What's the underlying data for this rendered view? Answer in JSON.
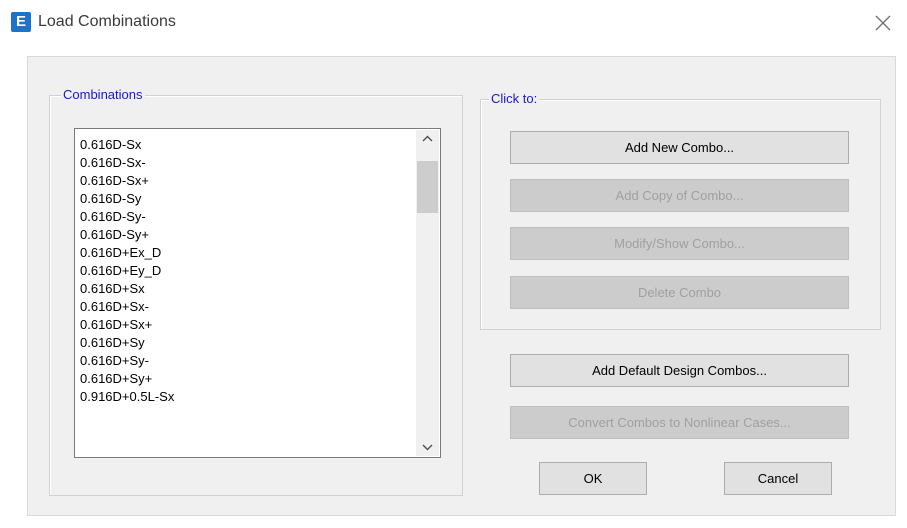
{
  "window": {
    "title": "Load Combinations",
    "app_icon_letter": "E"
  },
  "combinations": {
    "label": "Combinations",
    "items": [
      "0.616D-Sx",
      "0.616D-Sx-",
      "0.616D-Sx+",
      "0.616D-Sy",
      "0.616D-Sy-",
      "0.616D-Sy+",
      "0.616D+Ex_D",
      "0.616D+Ey_D",
      "0.616D+Sx",
      "0.616D+Sx-",
      "0.616D+Sx+",
      "0.616D+Sy",
      "0.616D+Sy-",
      "0.616D+Sy+",
      "0.916D+0.5L-Sx"
    ]
  },
  "click_to": {
    "label": "Click to:",
    "add_new": "Add New Combo...",
    "add_copy": "Add Copy of Combo...",
    "modify_show": "Modify/Show Combo...",
    "delete": "Delete Combo"
  },
  "buttons": {
    "add_default": "Add Default Design Combos...",
    "convert": "Convert Combos to Nonlinear Cases...",
    "ok": "OK",
    "cancel": "Cancel"
  },
  "colors": {
    "group_label": "#1a1ac8",
    "app_icon_bg": "#1e73c8",
    "dialog_bg": "#f0f0f0",
    "disabled_text": "#a0a0a0"
  },
  "icons": {
    "close": "close-icon",
    "scroll_up": "chevron-up-icon",
    "scroll_down": "chevron-down-icon"
  }
}
